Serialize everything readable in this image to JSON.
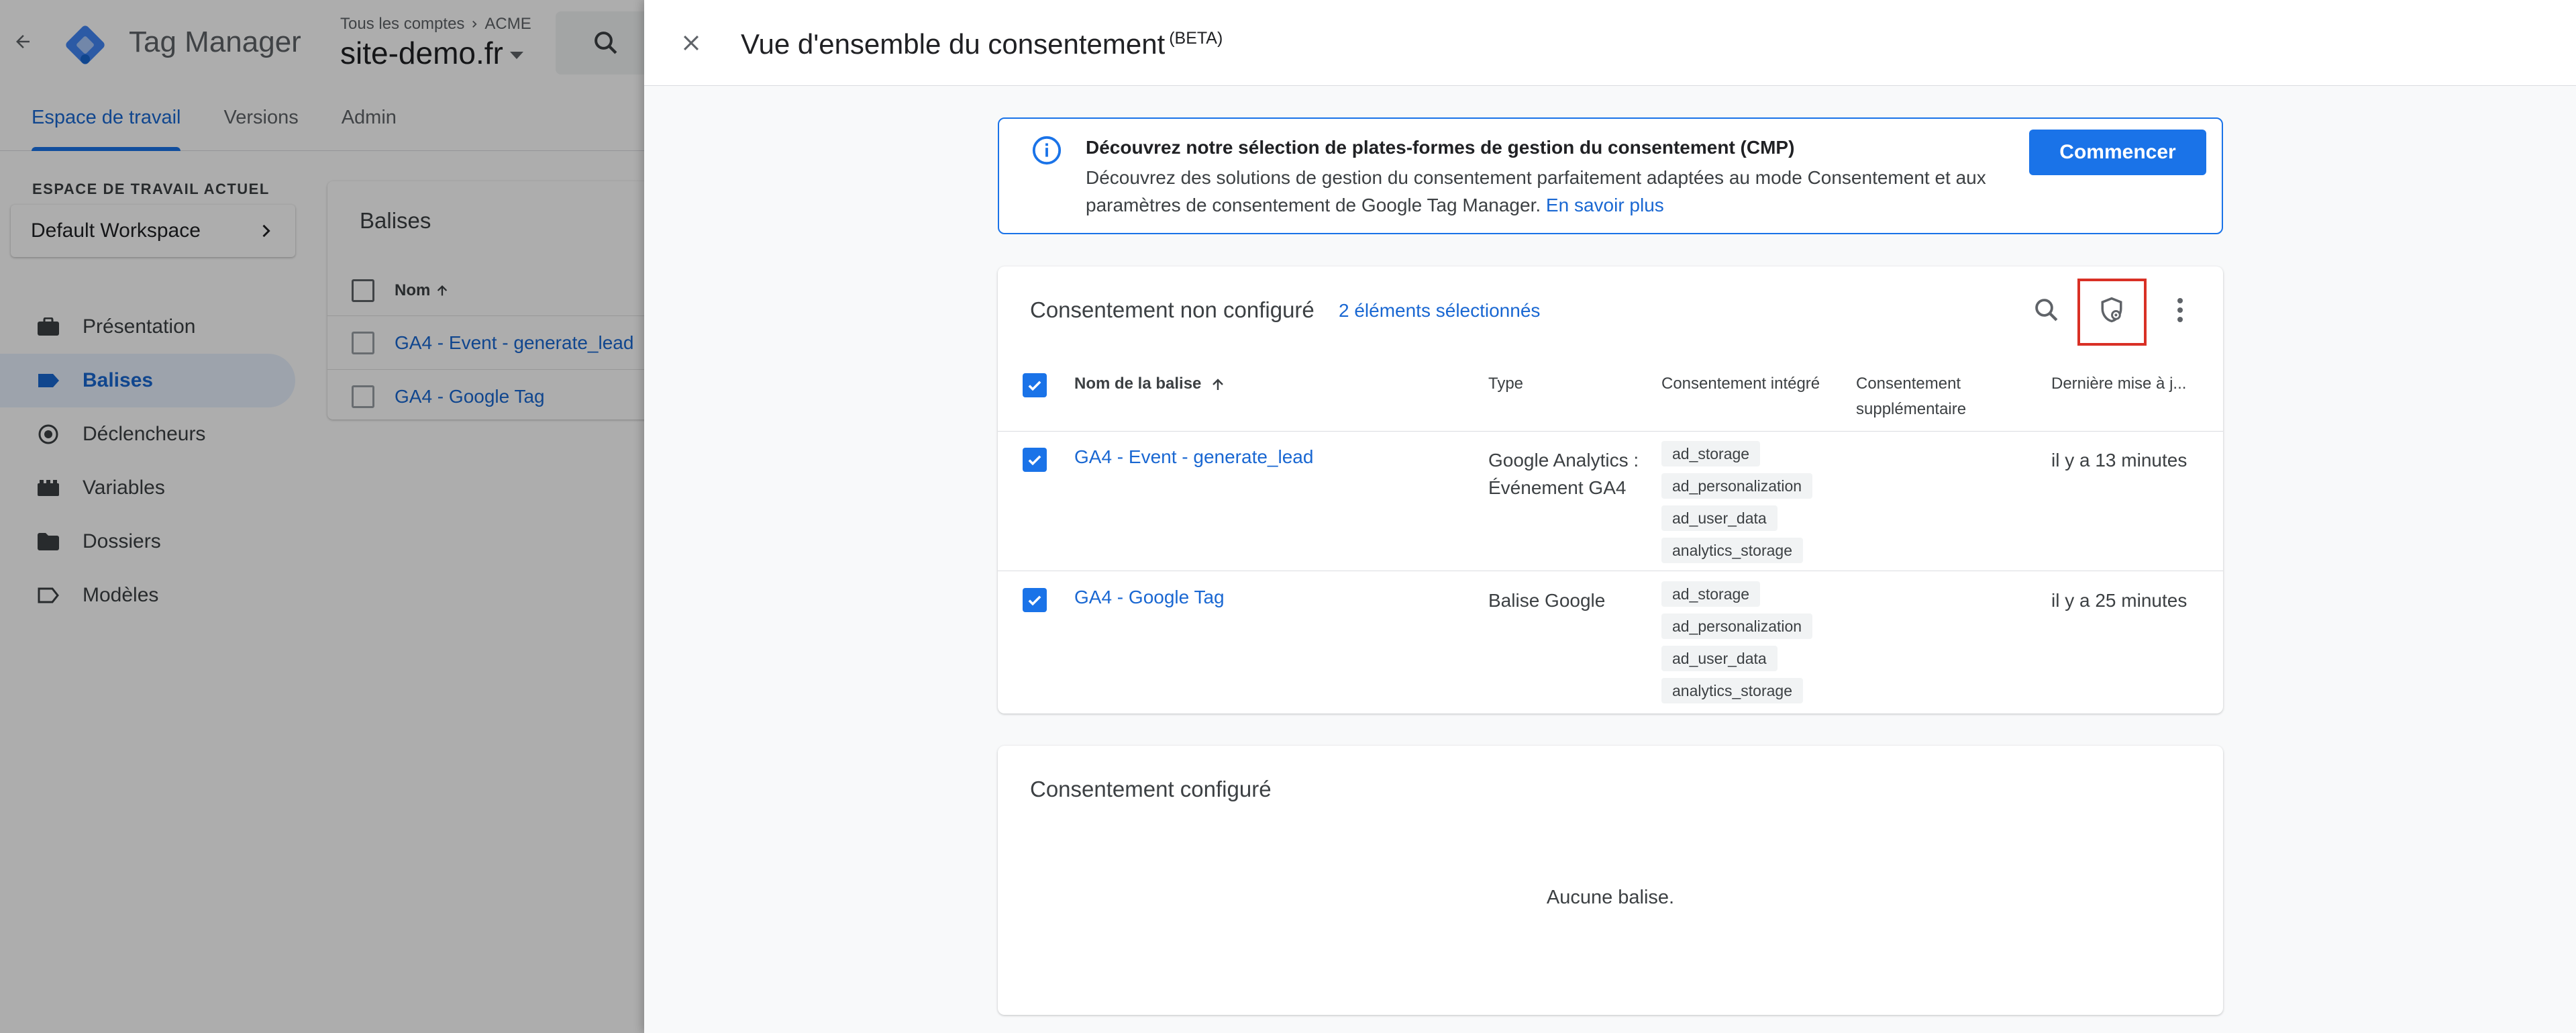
{
  "background": {
    "product_name": "Tag Manager",
    "breadcrumb_all_accounts": "Tous les comptes",
    "breadcrumb_account": "ACME",
    "container_name": "site-demo.fr",
    "nav_tabs": [
      {
        "label": "Espace de travail"
      },
      {
        "label": "Versions"
      },
      {
        "label": "Admin"
      }
    ],
    "workspace_label": "ESPACE DE TRAVAIL ACTUEL",
    "workspace_name": "Default Workspace",
    "sidebar_items": [
      {
        "label": "Présentation",
        "icon": "briefcase-icon"
      },
      {
        "label": "Balises",
        "icon": "tag-icon"
      },
      {
        "label": "Déclencheurs",
        "icon": "trigger-icon"
      },
      {
        "label": "Variables",
        "icon": "variables-icon"
      },
      {
        "label": "Dossiers",
        "icon": "folder-icon"
      },
      {
        "label": "Modèles",
        "icon": "template-icon"
      }
    ],
    "tags_card": {
      "title": "Balises",
      "column_name": "Nom",
      "rows": [
        "GA4 - Event - generate_lead",
        "GA4 - Google Tag"
      ]
    }
  },
  "panel": {
    "title": "Vue d'ensemble du consentement",
    "badge": "(BETA)",
    "banner": {
      "title": "Découvrez notre sélection de plates-formes de gestion du consentement (CMP)",
      "body": "Découvrez des solutions de gestion du consentement parfaitement adaptées au mode Consentement et aux paramètres de consentement de Google Tag Manager.",
      "link": "En savoir plus",
      "button": "Commencer"
    },
    "unconfigured": {
      "title": "Consentement non configuré",
      "selected": "2 éléments sélectionnés",
      "headers": {
        "name": "Nom de la balise",
        "type": "Type",
        "builtin": "Consentement intégré",
        "additional": "Consentement supplémentaire",
        "updated": "Dernière mise à j..."
      },
      "rows": [
        {
          "name": "GA4 - Event - generate_lead",
          "type": "Google Analytics : Événement GA4",
          "chips": [
            "ad_storage",
            "ad_personalization",
            "ad_user_data",
            "analytics_storage"
          ],
          "updated": "il y a 13 minutes"
        },
        {
          "name": "GA4 - Google Tag",
          "type": "Balise Google",
          "chips": [
            "ad_storage",
            "ad_personalization",
            "ad_user_data",
            "analytics_storage"
          ],
          "updated": "il y a 25 minutes"
        }
      ]
    },
    "configured": {
      "title": "Consentement configuré",
      "empty": "Aucune balise."
    }
  },
  "colors": {
    "accent": "#1a73e8",
    "link": "#1967d2",
    "highlight": "#d93025"
  }
}
